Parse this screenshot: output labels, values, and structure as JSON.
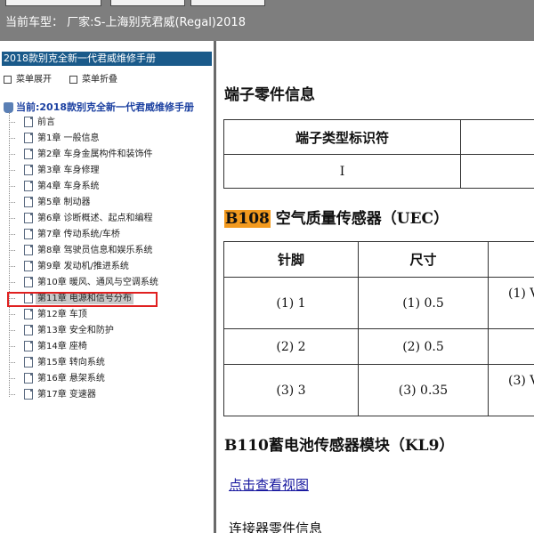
{
  "header": {
    "title": "当前车型： 厂家:S-上海别克君威(Regal)2018"
  },
  "sidebar": {
    "manual_title": "2018款别克全新一代君威维修手册",
    "expand_label": "菜单展开",
    "collapse_label": "菜单折叠",
    "current_label": "当前:2018款别克全新一代君威维修手册",
    "items": [
      {
        "label": "前言"
      },
      {
        "label": "第1章 一般信息"
      },
      {
        "label": "第2章 车身金属构件和装饰件"
      },
      {
        "label": "第3章 车身修理"
      },
      {
        "label": "第4章 车身系统"
      },
      {
        "label": "第5章 制动器"
      },
      {
        "label": "第6章 诊断概述、起点和编程"
      },
      {
        "label": "第7章 传动系统/车桥"
      },
      {
        "label": "第8章 驾驶员信息和娱乐系统"
      },
      {
        "label": "第9章 发动机/推进系统"
      },
      {
        "label": "第10章 暖风、通风与空调系统"
      },
      {
        "label": "第11章 电源和信号分布"
      },
      {
        "label": "第12章 车顶"
      },
      {
        "label": "第13章 安全和防护"
      },
      {
        "label": "第14章 座椅"
      },
      {
        "label": "第15章 转向系统"
      },
      {
        "label": "第16章 悬架系统"
      },
      {
        "label": "第17章 变速器"
      }
    ]
  },
  "content": {
    "terminal_heading": "端子零件信息",
    "terminal_table": {
      "header": "端子类型标识符",
      "value": "I"
    },
    "b108": {
      "tag": "B108",
      "title": " 空气质量传感器（UEC）",
      "headers": [
        "针脚",
        "尺寸"
      ],
      "rows": [
        {
          "pin": "(1) 1",
          "size": "(1) 0.5",
          "extra": "(1) V"
        },
        {
          "pin": "(2) 2",
          "size": "(2) 0.5",
          "extra": ""
        },
        {
          "pin": "(3) 3",
          "size": "(3) 0.35",
          "extra": "(3) V"
        }
      ]
    },
    "b110_title": "B110蓄电池传感器模块（KL9）",
    "view_link": "点击查看视图",
    "connector_info": "连接器零件信息"
  }
}
